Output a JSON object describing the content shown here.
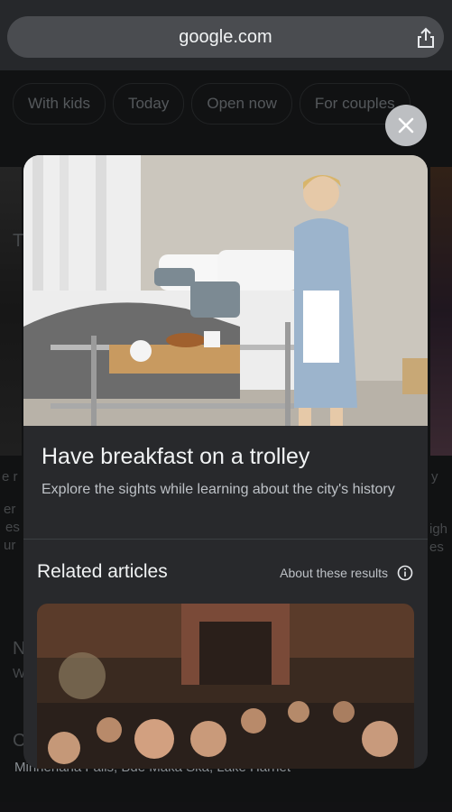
{
  "browser": {
    "url": "google.com"
  },
  "chips": [
    "With kids",
    "Today",
    "Open now",
    "For couples"
  ],
  "background": {
    "left_fragments": [
      "T",
      "e r",
      "er",
      "es",
      "ur",
      "N",
      "W",
      "C"
    ],
    "right_fragments": [
      "y",
      "igh",
      "es"
    ],
    "bottom_text": "Minnehaha Falls, Bde Maka Ska, Lake Harriet"
  },
  "card": {
    "title": "Have breakfast on a trolley",
    "subtitle": "Explore the sights while learning about the city's history",
    "related_heading": "Related articles",
    "about_link": "About these results"
  },
  "icons": {
    "share": "share-icon",
    "close": "close-icon",
    "info": "info-icon"
  }
}
